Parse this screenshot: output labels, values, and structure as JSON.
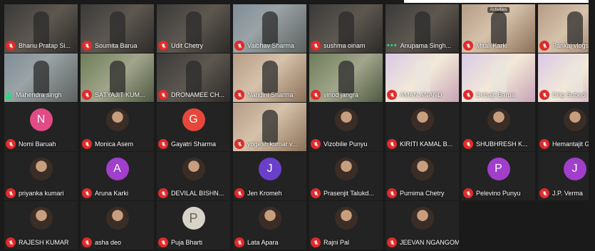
{
  "rows": [
    [
      {
        "name": "Bhanu Pratap Si...",
        "kind": "video",
        "tone": "dark",
        "muted": true
      },
      {
        "name": "Soumita Barua",
        "kind": "video",
        "tone": "dark",
        "muted": true
      },
      {
        "name": "Udit Chetry",
        "kind": "video",
        "tone": "dark",
        "muted": true
      },
      {
        "name": "Vaibhav Sharma",
        "kind": "video",
        "tone": "cool",
        "muted": true
      },
      {
        "name": "sushma oinam",
        "kind": "video",
        "tone": "dark",
        "muted": true
      },
      {
        "name": "Anupama Singh...",
        "kind": "video",
        "tone": "dark",
        "indicator": "dots"
      },
      {
        "name": "Mitali Karki",
        "kind": "video",
        "tone": "warm",
        "muted": true,
        "tag": "Activities"
      },
      {
        "name": "Pankaj vlogs",
        "kind": "video",
        "tone": "warm",
        "muted": true
      },
      {
        "name": "",
        "kind": "blank",
        "muted": false
      }
    ],
    [
      {
        "name": "Mahendra singh",
        "kind": "video",
        "tone": "cool",
        "indicator": "bars"
      },
      {
        "name": "SATYAJIT KUM...",
        "kind": "video",
        "tone": "green",
        "muted": true
      },
      {
        "name": "DRONAMEE CH...",
        "kind": "video",
        "tone": "dark",
        "muted": true
      },
      {
        "name": "Nandini Sharma",
        "kind": "video",
        "tone": "warm",
        "muted": true
      },
      {
        "name": "vinod jangra",
        "kind": "video",
        "tone": "green",
        "muted": true
      },
      {
        "name": "AMAN ANAND",
        "kind": "video",
        "tone": "bright",
        "muted": true
      },
      {
        "name": "Debajit Barua",
        "kind": "video",
        "tone": "bright",
        "muted": true
      },
      {
        "name": "Dilip Subedi",
        "kind": "video",
        "tone": "bright",
        "muted": true
      },
      {
        "name": "",
        "kind": "blank",
        "muted": false
      }
    ],
    [
      {
        "name": "Nomi Baruah",
        "kind": "avatar",
        "letter": "N",
        "color": "pink",
        "muted": true
      },
      {
        "name": "Monica Asem",
        "kind": "avatar",
        "color": "photo",
        "muted": true
      },
      {
        "name": "Gayatri Sharma",
        "kind": "avatar",
        "letter": "G",
        "color": "red",
        "muted": true
      },
      {
        "name": "yogesh kumar v...",
        "kind": "video",
        "tone": "warm",
        "muted": true
      },
      {
        "name": "Vizobilie Punyu",
        "kind": "avatar",
        "color": "photo",
        "muted": true
      },
      {
        "name": "KIRITI KAMAL B...",
        "kind": "avatar",
        "color": "photo",
        "muted": true
      },
      {
        "name": "SHUBHRESH K...",
        "kind": "avatar",
        "color": "photo",
        "muted": true
      },
      {
        "name": "Hemantajit Gogoi",
        "kind": "avatar",
        "color": "photo",
        "muted": true
      },
      {
        "name": "",
        "kind": "blank",
        "muted": false
      }
    ],
    [
      {
        "name": "priyanka kumari",
        "kind": "avatar",
        "color": "photo",
        "muted": true
      },
      {
        "name": "Aruna Karki",
        "kind": "avatar",
        "letter": "A",
        "color": "purple",
        "muted": true
      },
      {
        "name": "DEVILAL BISHN...",
        "kind": "avatar",
        "color": "photo",
        "muted": true
      },
      {
        "name": "Jen Kromeh",
        "kind": "avatar",
        "letter": "J",
        "color": "violet",
        "muted": true
      },
      {
        "name": "Prasenjit Talukd...",
        "kind": "avatar",
        "color": "photo",
        "muted": true
      },
      {
        "name": "Purnima Chetry",
        "kind": "avatar",
        "color": "photo",
        "muted": true
      },
      {
        "name": "Pelevino Punyu",
        "kind": "avatar",
        "letter": "P",
        "color": "purple",
        "muted": true
      },
      {
        "name": "J.P. Verma",
        "kind": "avatar",
        "letter": "J",
        "color": "purple",
        "muted": true
      },
      {
        "name": "",
        "kind": "blank",
        "muted": false
      }
    ],
    [
      {
        "name": "RAJESH KUMAR",
        "kind": "avatar",
        "color": "photo",
        "muted": true
      },
      {
        "name": "asha deo",
        "kind": "avatar",
        "color": "photo",
        "muted": true
      },
      {
        "name": "Puja Bharti",
        "kind": "avatar",
        "letter": "P",
        "color": "beige",
        "muted": true
      },
      {
        "name": "Lata Apara",
        "kind": "avatar",
        "color": "photo",
        "muted": true
      },
      {
        "name": "Rajni Pal",
        "kind": "avatar",
        "color": "photo",
        "muted": true
      },
      {
        "name": "JEEVAN NGANGOM",
        "kind": "avatar",
        "color": "photo",
        "muted": true
      },
      {
        "name": "",
        "kind": "blank",
        "muted": false
      },
      {
        "name": "",
        "kind": "blank",
        "muted": false
      },
      {
        "name": "",
        "kind": "blank",
        "muted": false
      }
    ]
  ],
  "colors": {
    "background": "#1a1a1a",
    "tile": "#232323",
    "mute": "#e02a2a",
    "speaking": "#35d07f"
  }
}
